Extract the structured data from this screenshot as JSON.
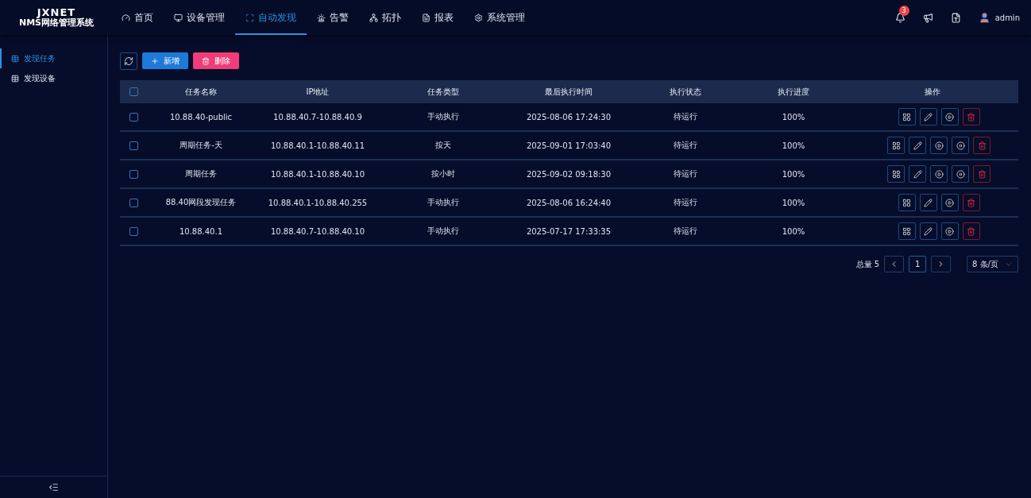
{
  "logo": {
    "line1": "JXNET",
    "line2": "NMS网络管理系统"
  },
  "nav": [
    {
      "label": "首页",
      "selected": false
    },
    {
      "label": "设备管理",
      "selected": false
    },
    {
      "label": "自动发现",
      "selected": true
    },
    {
      "label": "告警",
      "selected": false
    },
    {
      "label": "拓扑",
      "selected": false
    },
    {
      "label": "报表",
      "selected": false
    },
    {
      "label": "系统管理",
      "selected": false
    }
  ],
  "header_right": {
    "notifications": "3",
    "user": "admin"
  },
  "sidebar": {
    "items": [
      {
        "label": "发现任务",
        "selected": true
      },
      {
        "label": "发现设备",
        "selected": false
      }
    ]
  },
  "toolbar": {
    "add": "新增",
    "delete": "删除"
  },
  "table": {
    "select_all_checked": false,
    "columns": [
      "任务名称",
      "IP地址",
      "任务类型",
      "最后执行时间",
      "执行状态",
      "执行进度",
      "操作"
    ],
    "rows": [
      {
        "checked": false,
        "cells": [
          "10.88.40-public",
          "10.88.40.7-10.88.40.9",
          "手动执行",
          "2025-08-06 17:24:30",
          "待运行",
          "100%"
        ],
        "actions": [
          {
            "kind": "view"
          },
          {
            "kind": "edit"
          },
          {
            "kind": "run"
          },
          {
            "kind": "delete"
          }
        ]
      },
      {
        "checked": false,
        "cells": [
          "周期任务-天",
          "10.88.40.1-10.88.40.11",
          "按天",
          "2025-09-01 17:03:40",
          "待运行",
          "100%"
        ],
        "actions": [
          {
            "kind": "view"
          },
          {
            "kind": "edit"
          },
          {
            "kind": "run"
          },
          {
            "kind": "pause"
          },
          {
            "kind": "delete"
          }
        ]
      },
      {
        "checked": false,
        "cells": [
          "周期任务",
          "10.88.40.1-10.88.40.10",
          "按小时",
          "2025-09-02 09:18:30",
          "待运行",
          "100%"
        ],
        "actions": [
          {
            "kind": "view"
          },
          {
            "kind": "edit"
          },
          {
            "kind": "run"
          },
          {
            "kind": "pause"
          },
          {
            "kind": "delete"
          }
        ]
      },
      {
        "checked": false,
        "cells": [
          "88.40网段发现任务",
          "10.88.40.1-10.88.40.255",
          "手动执行",
          "2025-08-06 16:24:40",
          "待运行",
          "100%"
        ],
        "actions": [
          {
            "kind": "view"
          },
          {
            "kind": "edit"
          },
          {
            "kind": "run"
          },
          {
            "kind": "delete"
          }
        ]
      },
      {
        "checked": false,
        "cells": [
          "10.88.40.1",
          "10.88.40.7-10.88.40.10",
          "手动执行",
          "2025-07-17 17:33:35",
          "待运行",
          "100%"
        ],
        "actions": [
          {
            "kind": "view"
          },
          {
            "kind": "edit"
          },
          {
            "kind": "run"
          },
          {
            "kind": "delete"
          }
        ]
      }
    ]
  },
  "pagination": {
    "total": "总量 5",
    "pages": [
      {
        "label": "1",
        "selected": true
      }
    ],
    "page_size": "8 条/页"
  }
}
